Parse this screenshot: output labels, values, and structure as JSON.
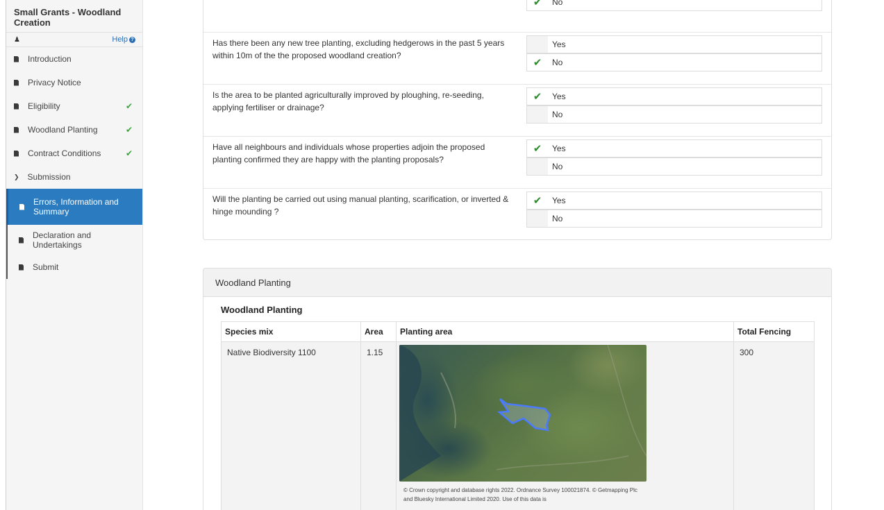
{
  "sidebar": {
    "title": "Small Grants - Woodland Creation",
    "help_label": "Help",
    "items": [
      {
        "label": "Introduction",
        "done": false
      },
      {
        "label": "Privacy Notice",
        "done": false
      },
      {
        "label": "Eligibility",
        "done": true
      },
      {
        "label": "Woodland Planting",
        "done": true
      },
      {
        "label": "Contract Conditions",
        "done": true
      }
    ],
    "section_label": "Submission",
    "sub_items": [
      {
        "label": "Errors, Information and Summary",
        "active": true
      },
      {
        "label": "Declaration and Undertakings",
        "active": false
      },
      {
        "label": "Submit",
        "active": false
      }
    ]
  },
  "questions": [
    {
      "text": "",
      "options": [
        {
          "label": "No",
          "selected": true
        }
      ]
    },
    {
      "text": "Has there been any new tree planting, excluding hedgerows in the past 5 years within 10m of the the proposed woodland creation?",
      "options": [
        {
          "label": "Yes",
          "selected": false
        },
        {
          "label": "No",
          "selected": true
        }
      ]
    },
    {
      "text": "Is the area to be planted agriculturally improved by ploughing, re-seeding, applying fertiliser or drainage?",
      "options": [
        {
          "label": "Yes",
          "selected": true
        },
        {
          "label": "No",
          "selected": false
        }
      ]
    },
    {
      "text": "Have all neighbours and individuals whose properties adjoin the proposed planting confirmed they are happy with the planting proposals?",
      "options": [
        {
          "label": "Yes",
          "selected": true
        },
        {
          "label": "No",
          "selected": false
        }
      ]
    },
    {
      "text": "Will the planting be carried out using manual planting, scarification, or inverted & hinge mounding ?",
      "options": [
        {
          "label": "Yes",
          "selected": true
        },
        {
          "label": "No",
          "selected": false
        }
      ]
    }
  ],
  "woodland": {
    "panel_title": "Woodland Planting",
    "table_title": "Woodland Planting",
    "columns": [
      "Species mix",
      "Area",
      "Planting area",
      "Total Fencing"
    ],
    "rows": [
      {
        "species": "Native Biodiversity 1100",
        "area": "1.15",
        "fencing": "300",
        "map_caption": "© Crown copyright and database rights 2022. Ordnance Survey 100021874. © Getmapping Plc and Bluesky International Limited 2020. Use of this data is"
      }
    ]
  },
  "colors": {
    "accent": "#2a7bc0",
    "check": "#3aa53a"
  }
}
